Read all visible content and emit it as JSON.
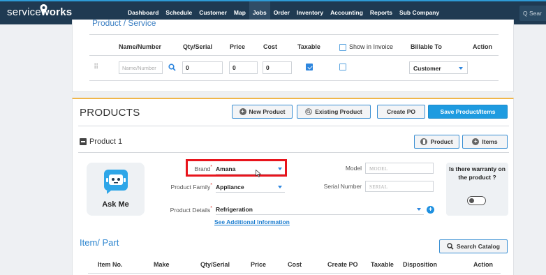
{
  "app": {
    "logo_left": "service",
    "logo_right": "works"
  },
  "nav": [
    "Dashboard",
    "Schedule",
    "Customer",
    "Map",
    "Jobs",
    "Order",
    "Inventory",
    "Accounting",
    "Reports",
    "Sub Company"
  ],
  "nav_active": "Jobs",
  "top_search": "Q Sear",
  "product_service": {
    "title": "Product / Service",
    "headers": [
      "Name/Number",
      "Qty/Serial",
      "Price",
      "Cost",
      "Taxable",
      "Show in Invoice",
      "Billable To",
      "Action"
    ],
    "row": {
      "name_placeholder": "Name/Number",
      "qty": "0",
      "price": "0",
      "cost": "0",
      "taxable": true,
      "show_in_invoice": false,
      "billable_to": "Customer"
    }
  },
  "products": {
    "title": "PRODUCTS",
    "buttons": {
      "new_product": "New Product",
      "existing_product": "Existing Product",
      "create_po": "Create PO",
      "save": "Save Product/Items"
    },
    "product1": {
      "title": "Product 1",
      "btn_product": "Product",
      "btn_items": "Items",
      "ask_me": "Ask Me",
      "brand_label": "Brand",
      "brand": "Amana",
      "family_label": "Product Family",
      "family": "Appliance",
      "details_label": "Product Details",
      "details": "Refrigeration",
      "model_label": "Model",
      "model_placeholder": "MODEL",
      "serial_label": "Serial Number",
      "serial_placeholder": "SERIAL",
      "additional_link": "See Additional Information",
      "warranty_question": "Is there warranty on the product ?"
    },
    "item_part": {
      "title": "Item/ Part",
      "search_catalog": "Search Catalog",
      "headers": [
        "Item No.",
        "Make",
        "Qty/Serial",
        "Price",
        "Cost",
        "Create PO",
        "Taxable",
        "Disposition",
        "Action"
      ]
    }
  },
  "colors": {
    "nav_bg": "#1f3a52",
    "accent": "#1e9be0",
    "highlight": "#e8141c",
    "products_border": "#f0b64a"
  }
}
